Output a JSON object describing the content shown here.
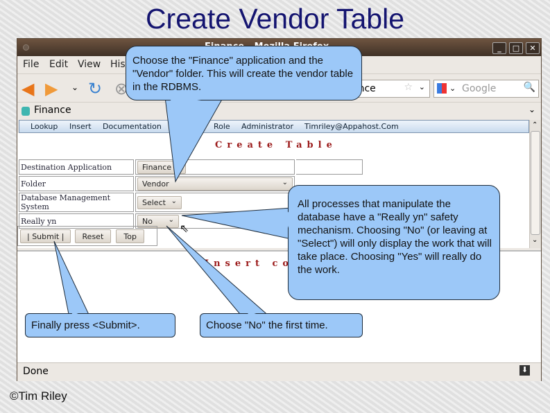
{
  "slide": {
    "title": "Create Vendor Table",
    "copyright": "©Tim Riley"
  },
  "browser": {
    "window_title": "Finance - Mozilla Firefox",
    "menu": [
      "File",
      "Edit",
      "View",
      "History"
    ],
    "url": "ance",
    "search_placeholder": "Google",
    "tab_label": "Finance",
    "status": "Done"
  },
  "page": {
    "nav": [
      "Lookup",
      "Insert",
      "Documentation",
      "Role",
      "Administrator",
      "Timriley@Appahost.Com"
    ],
    "heading": "Create Table",
    "heading2": "Insert co",
    "form": [
      {
        "label": "Destination Application",
        "value": "Finance"
      },
      {
        "label": "Folder",
        "value": "Vendor"
      },
      {
        "label": "Database Management System",
        "value": "Select"
      },
      {
        "label": "Really yn",
        "value": "No"
      }
    ],
    "buttons": {
      "submit": "|   Submit   |",
      "reset": "Reset",
      "top": "Top"
    }
  },
  "callouts": {
    "c1": "Choose the \"Finance\" application and the \"Vendor\" folder. This will create the vendor table in the RDBMS.",
    "c2": "All processes that manipulate the database have a \"Really yn\" safety mechanism. Choosing \"No\" (or leaving at \"Select\") will only display the work that will take place. Choosing \"Yes\" will really do the work.",
    "c3": "Finally press <Submit>.",
    "c4": "Choose \"No\" the first time."
  },
  "colors": {
    "title": "#141470",
    "callout": "#9cc8f8",
    "heading": "#9b1a1a"
  }
}
